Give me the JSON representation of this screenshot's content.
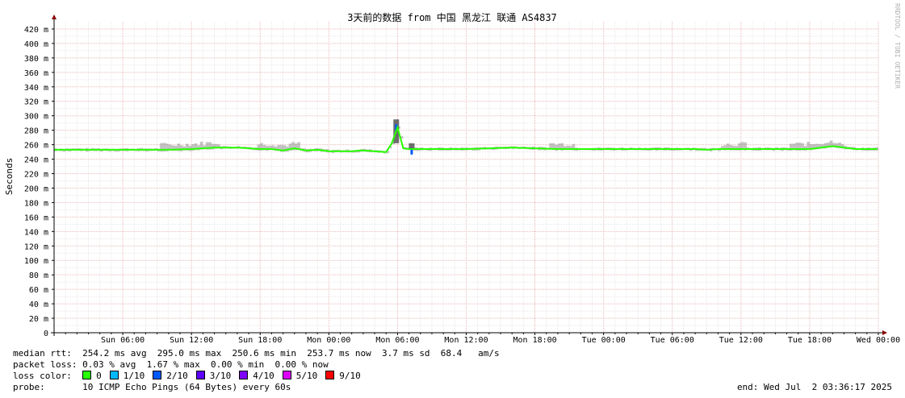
{
  "chart_data": {
    "type": "line",
    "title": "3天前的数据 from 中国 黑龙江 联通 AS4837",
    "ylabel": "Seconds",
    "ylim": [
      0,
      0.43
    ],
    "ytick_values": [
      0,
      0.02,
      0.04,
      0.06,
      0.08,
      0.1,
      0.12,
      0.14,
      0.16,
      0.18,
      0.2,
      0.22,
      0.24,
      0.26,
      0.28,
      0.3,
      0.32,
      0.34,
      0.36,
      0.38,
      0.4,
      0.42
    ],
    "ytick_labels": [
      "0",
      "20 m",
      "40 m",
      "60 m",
      "80 m",
      "100 m",
      "120 m",
      "140 m",
      "160 m",
      "180 m",
      "200 m",
      "220 m",
      "240 m",
      "260 m",
      "280 m",
      "300 m",
      "320 m",
      "340 m",
      "360 m",
      "380 m",
      "400 m",
      "420 m"
    ],
    "x_hours": [
      0,
      6,
      12,
      18,
      24,
      30,
      36,
      42,
      48,
      54,
      60,
      66,
      72
    ],
    "xtick_labels": [
      "Sun 06:00",
      "Sun 12:00",
      "Sun 18:00",
      "Mon 00:00",
      "Mon 06:00",
      "Mon 12:00",
      "Mon 18:00",
      "Tue 00:00",
      "Tue 06:00",
      "Tue 12:00",
      "Tue 18:00",
      "Wed 00:00"
    ],
    "grid": true,
    "series": [
      {
        "values_hours": [
          0,
          8,
          10,
          12,
          14,
          16,
          18,
          19,
          20,
          21,
          22,
          23,
          24,
          25,
          26,
          26.8,
          27,
          28.8,
          29,
          29.5,
          30,
          30.5,
          31,
          32,
          34,
          36,
          40,
          44,
          48,
          52,
          56,
          57,
          58,
          60,
          62,
          64,
          66,
          67,
          68,
          70,
          72
        ],
        "values": [
          0.253,
          0.253,
          0.253,
          0.254,
          0.256,
          0.256,
          0.254,
          0.254,
          0.252,
          0.255,
          0.252,
          0.253,
          0.251,
          0.251,
          0.251,
          0.252,
          0.252,
          0.25,
          0.25,
          0.262,
          0.284,
          0.255,
          0.254,
          0.254,
          0.254,
          0.254,
          0.256,
          0.254,
          0.254,
          0.254,
          0.254,
          0.253,
          0.254,
          0.254,
          0.254,
          0.254,
          0.254,
          0.256,
          0.258,
          0.254,
          0.254
        ]
      }
    ],
    "spikes": [
      {
        "hour": 29.85,
        "low": 0.262,
        "high": 0.295
      },
      {
        "hour": 31.2,
        "low": 0.255,
        "high": 0.262
      }
    ]
  },
  "legend": {
    "median_rtt": "median rtt:  254.2 ms avg  295.0 ms max  250.6 ms min  253.7 ms now  3.7 ms sd  68.4   am/s",
    "packet_loss": "packet loss: 0.03 % avg  1.67 % max  0.00 % min  0.00 % now",
    "loss_color_label": "loss color:  ",
    "loss_colors": [
      {
        "label": "0",
        "color": "#26ff00"
      },
      {
        "label": "1/10",
        "color": "#00b8ff"
      },
      {
        "label": "2/10",
        "color": "#0059ff"
      },
      {
        "label": "3/10",
        "color": "#5e00ff"
      },
      {
        "label": "4/10",
        "color": "#7e00ff"
      },
      {
        "label": "5/10",
        "color": "#dd00ff"
      },
      {
        "label": "9/10",
        "color": "#ff0000"
      }
    ],
    "probe": "probe:       10 ICMP Echo Pings (64 Bytes) every 60s",
    "end": "end: Wed Jul  2 03:36:17 2025"
  },
  "watermark": "RRDTOOL / TOBI OETIKER",
  "colors": {
    "grid_minor": "#e8e8e8",
    "grid_major": "#e8b8b8",
    "line": "#26ff00",
    "smoke": "#909090",
    "axis": "#000000",
    "arrow": "#8b0000"
  }
}
